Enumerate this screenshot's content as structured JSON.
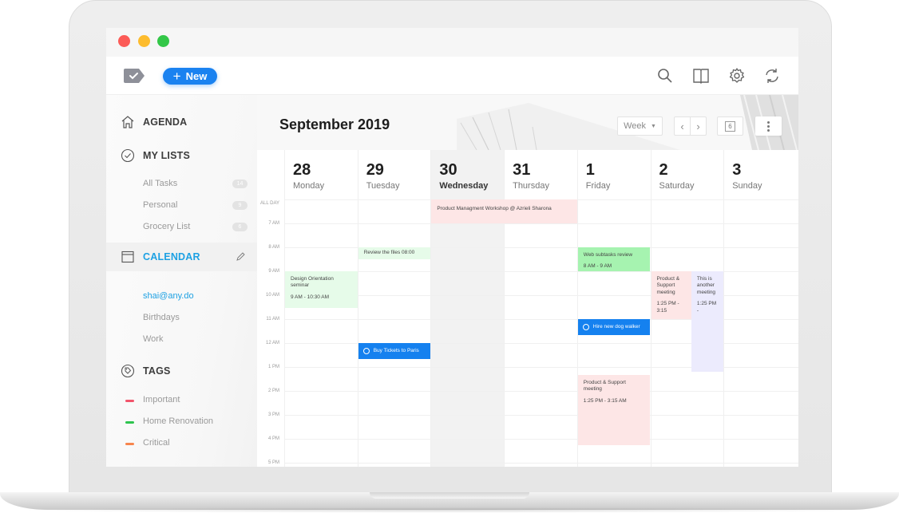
{
  "window": {
    "traffic_lights": [
      "close",
      "minimize",
      "zoom"
    ]
  },
  "toolbar": {
    "logo_icon": "tag-check-icon",
    "new_button": {
      "icon": "plus",
      "label": "New"
    },
    "icons": [
      "search-icon",
      "book-icon",
      "gear-icon",
      "sync-icon"
    ],
    "accent_color": "#1a82f0"
  },
  "sidebar": {
    "agenda": {
      "label": "AGENDA",
      "icon": "home-icon"
    },
    "my_lists": {
      "label": "MY LISTS",
      "icon": "check-circle-icon",
      "items": [
        {
          "label": "All Tasks",
          "count": "14"
        },
        {
          "label": "Personal",
          "count": "9"
        },
        {
          "label": "Grocery List",
          "count": "6"
        }
      ]
    },
    "calendar": {
      "label": "CALENDAR",
      "icon": "calendar-icon",
      "edit_icon": "pencil-icon",
      "items": [
        {
          "label": "shai@any.do",
          "active": true
        },
        {
          "label": "Birthdays"
        },
        {
          "label": "Work"
        }
      ]
    },
    "tags": {
      "label": "TAGS",
      "icon": "tag-icon",
      "items": [
        {
          "label": "Important",
          "color": "#f2546b"
        },
        {
          "label": "Home Renovation",
          "color": "#2ec44e"
        },
        {
          "label": "Critical",
          "color": "#f7854d"
        }
      ]
    }
  },
  "calendar": {
    "title": "September 2019",
    "view_select": "Week",
    "today_button": "6",
    "days": [
      {
        "num": "28",
        "name": "Monday"
      },
      {
        "num": "29",
        "name": "Tuesday"
      },
      {
        "num": "30",
        "name": "Wednesday",
        "today": true
      },
      {
        "num": "31",
        "name": "Thursday"
      },
      {
        "num": "1",
        "name": "Friday"
      },
      {
        "num": "2",
        "name": "Saturday"
      },
      {
        "num": "3",
        "name": "Sunday"
      }
    ],
    "time_labels": [
      "ALL DAY",
      "7 AM",
      "8 AM",
      "9 AM",
      "10 AM",
      "11 AM",
      "12 AM",
      "1 PM",
      "2 PM",
      "3 PM",
      "4 PM",
      "5 PM"
    ],
    "events": [
      {
        "title": "Product Managment Workshop @ Azrieli Sharona",
        "time": "",
        "type": "all-day"
      },
      {
        "title": "Review the files 08:00",
        "time": "",
        "type": "task"
      },
      {
        "title": "Design Orientation seminar",
        "time": "9 AM - 10:30 AM",
        "type": "event"
      },
      {
        "title": "Buy Tickets to Paris",
        "time": "",
        "type": "reminder"
      },
      {
        "title": "Web subtasks review",
        "time": "8 AM - 9 AM",
        "type": "event"
      },
      {
        "title": "Hire new dog walker",
        "time": "",
        "type": "reminder"
      },
      {
        "title": "Product & Support meeting",
        "time": "1:25 PM - 3:15",
        "type": "event"
      },
      {
        "title": "This is another meeting",
        "time": "1:25 PM -",
        "type": "event"
      },
      {
        "title": "Product & Support meeting",
        "time": "1:25 PM - 3:15 AM",
        "type": "event"
      }
    ]
  }
}
